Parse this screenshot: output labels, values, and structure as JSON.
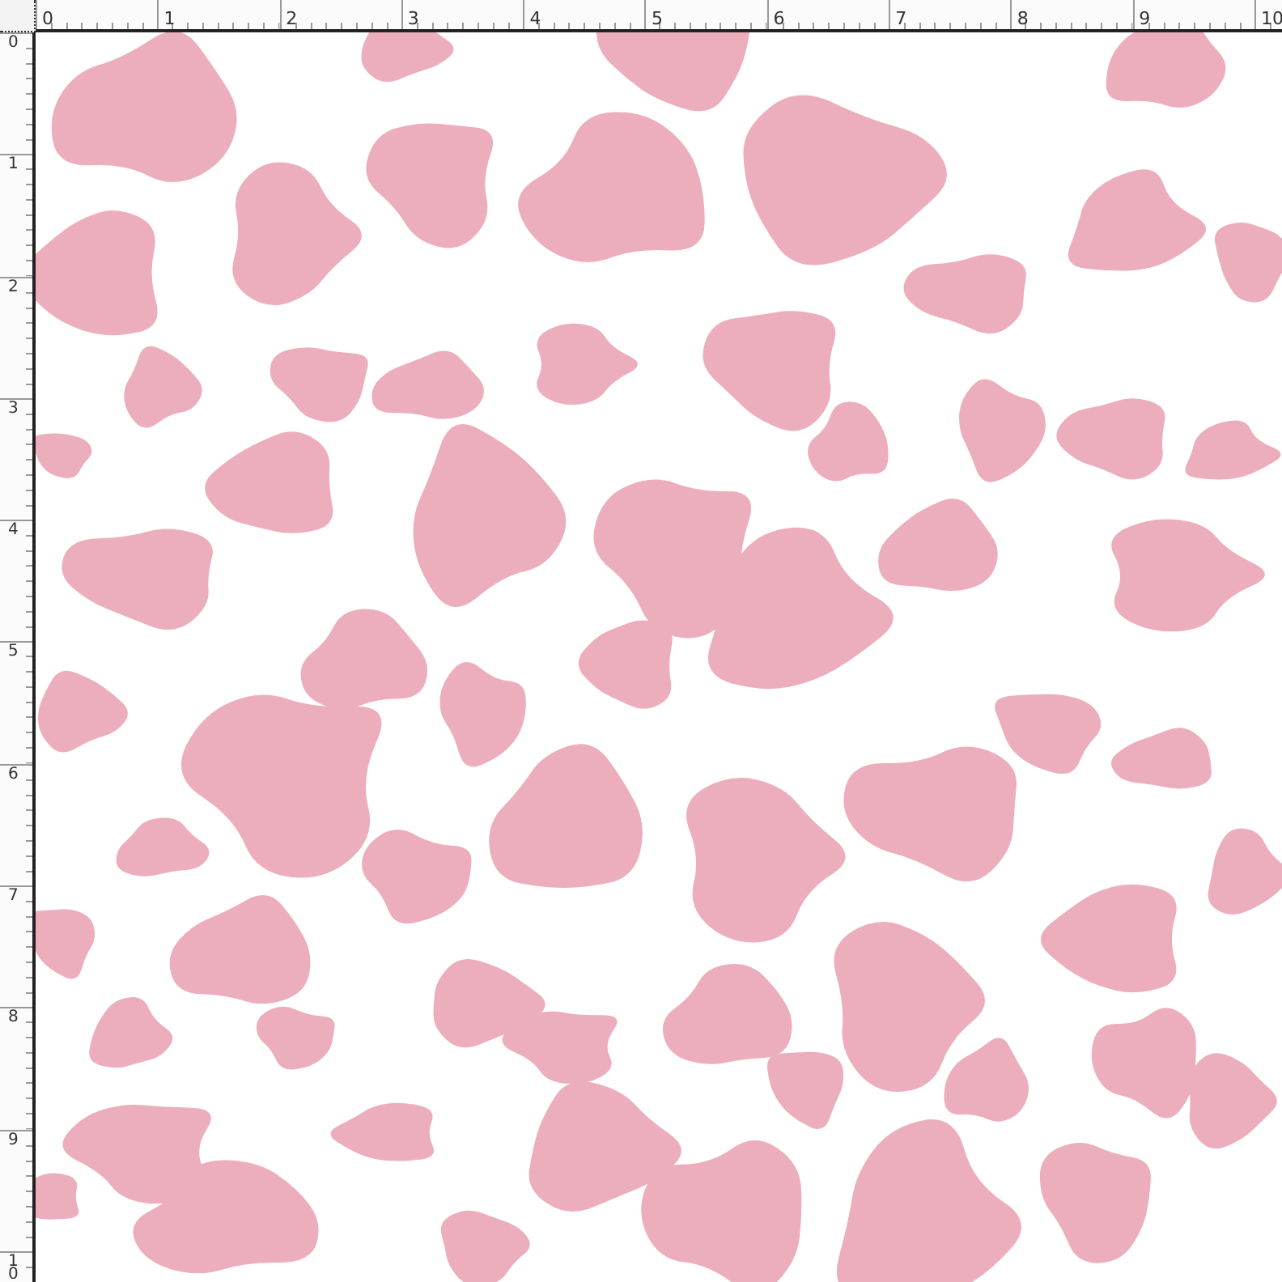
{
  "ruler_top": {
    "labels": [
      "0",
      "1",
      "2",
      "3",
      "4",
      "5",
      "6",
      "7",
      "8",
      "9",
      "10"
    ]
  },
  "ruler_left": {
    "labels": [
      "0",
      "1",
      "2",
      "3",
      "4",
      "5",
      "6",
      "7",
      "8",
      "9",
      "10"
    ]
  }
}
